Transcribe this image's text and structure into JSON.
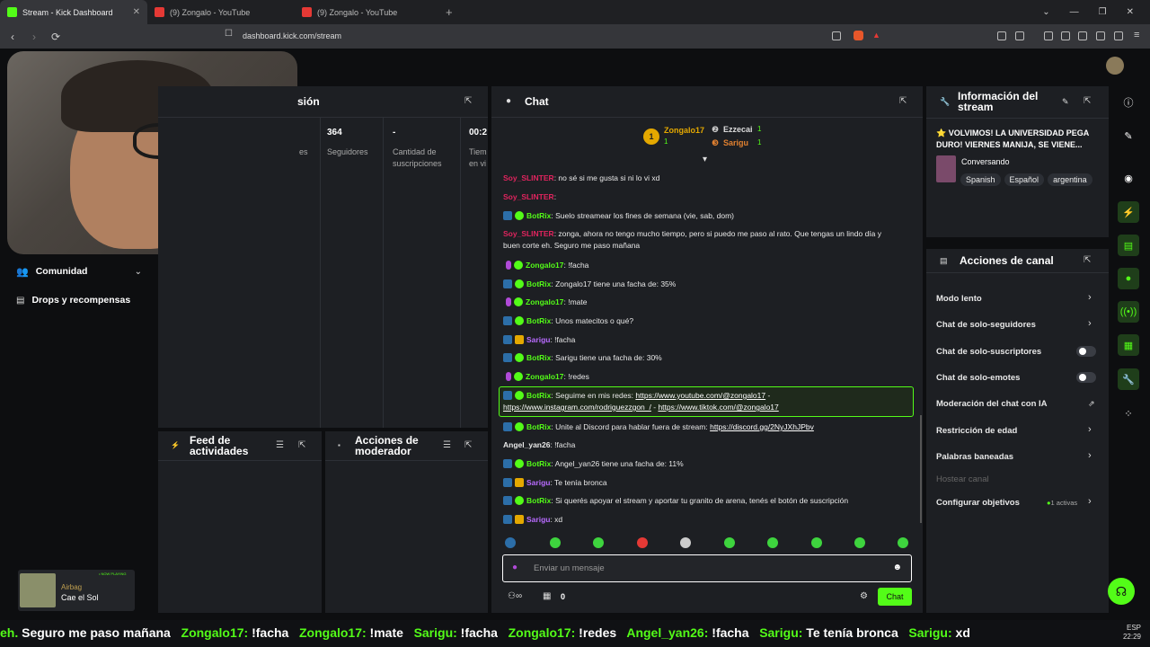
{
  "browser": {
    "tabs": [
      {
        "title": "Stream - Kick Dashboard",
        "active": true,
        "favicon": "#53fc18"
      },
      {
        "title": "(9) Zongalo - YouTube",
        "active": false,
        "favicon": "#e53935"
      },
      {
        "title": "(9) Zongalo - YouTube",
        "active": false,
        "favicon": "#e53935"
      }
    ],
    "url": "dashboard.kick.com/stream"
  },
  "left_nav": {
    "items": [
      {
        "label": "Comunidad"
      },
      {
        "label": "Drops y recompensas"
      }
    ]
  },
  "session_panel": {
    "title_fragment": "sión",
    "stats": [
      {
        "value": "364",
        "label": "Seguidores"
      },
      {
        "value": "-",
        "label": "Cantidad de suscripciones"
      },
      {
        "value": "00:2",
        "label": "Tiem en vi"
      }
    ],
    "partial_label": "es"
  },
  "activity_feed": {
    "title": "Feed de actividades"
  },
  "mod_actions": {
    "title": "Acciones de moderador"
  },
  "now_playing": {
    "badge": "• NOW PLAYING",
    "artist": "Airbag",
    "song": "Cae el Sol"
  },
  "chat": {
    "title": "Chat",
    "leaderboard": [
      {
        "rank": "1",
        "user": "Zongalo17",
        "count": "1"
      },
      {
        "user": "Ezzecai",
        "count": "1"
      },
      {
        "user": "Sarigu",
        "count": "1"
      }
    ],
    "messages": [
      {
        "user": "Soy_SLINTER",
        "user_color": "#e0245e",
        "text": ": no sé si me gusta si ni lo vi xd",
        "badges": []
      },
      {
        "user": "Soy_SLINTER",
        "user_color": "#e0245e",
        "text": ":",
        "badges": []
      },
      {
        "user": "BotRix",
        "user_color": "#53fc18",
        "text": ": Suelo streamear los fines de semana (vie, sab, dom)",
        "badges": [
          "mod",
          "ver"
        ]
      },
      {
        "user": "Soy_SLINTER",
        "user_color": "#e0245e",
        "text": ": zonga, ahora no tengo mucho tiempo, pero si puedo me paso al rato. Que tengas un lindo día y",
        "text2": "buen corte eh. Seguro me paso mañana",
        "badges": []
      },
      {
        "user": "Zongalo17",
        "user_color": "#53fc18",
        "text": ": !facha",
        "badges": [
          "mic",
          "ver"
        ]
      },
      {
        "user": "BotRix",
        "user_color": "#53fc18",
        "text": ": Zongalo17 tiene una facha de: 35%",
        "badges": [
          "mod",
          "ver"
        ]
      },
      {
        "user": "Zongalo17",
        "user_color": "#53fc18",
        "text": ": !mate",
        "badges": [
          "mic",
          "ver"
        ]
      },
      {
        "user": "BotRix",
        "user_color": "#53fc18",
        "text": ": Unos matecitos o qué?",
        "badges": [
          "mod",
          "ver"
        ]
      },
      {
        "user": "Sarigu",
        "user_color": "#b86bff",
        "text": ": !facha",
        "badges": [
          "mod",
          "crown"
        ]
      },
      {
        "user": "BotRix",
        "user_color": "#53fc18",
        "text": ": Sarigu tiene una facha de: 30%",
        "badges": [
          "mod",
          "ver"
        ]
      },
      {
        "user": "Zongalo17",
        "user_color": "#53fc18",
        "text": ": !redes",
        "badges": [
          "mic",
          "ver"
        ]
      },
      {
        "user": "BotRix",
        "user_color": "#53fc18",
        "text": ": Seguime en mis redes: ",
        "link1": "https://www.youtube.com/@zongalo17",
        "sep1": " -",
        "link2": "https://www.instagram.com/rodriguezzgon_/",
        "sep2": " - ",
        "link3": "https://www.tiktok.com/@zongalo17",
        "badges": [
          "mod",
          "ver"
        ]
      },
      {
        "user": "BotRix",
        "user_color": "#53fc18",
        "text": ": Unite al Discord para hablar fuera de stream: ",
        "link1": "https://discord.gg/2NyJXhJPbv",
        "badges": [
          "mod",
          "ver"
        ]
      },
      {
        "user": "Angel_yan26",
        "user_color": "#e8e8e8",
        "text": ": !facha",
        "badges": []
      },
      {
        "user": "BotRix",
        "user_color": "#53fc18",
        "text": ": Angel_yan26 tiene una facha de: 11%",
        "badges": [
          "mod",
          "ver"
        ]
      },
      {
        "user": "Sarigu",
        "user_color": "#b86bff",
        "text": ": Te tenía bronca",
        "badges": [
          "mod",
          "crown"
        ]
      },
      {
        "user": "BotRix",
        "user_color": "#53fc18",
        "text": ": Si querés apoyar el stream y aportar tu granito de arena, tenés el botón de suscripción",
        "badges": [
          "mod",
          "ver"
        ]
      },
      {
        "user": "Sarigu",
        "user_color": "#b86bff",
        "text": ": xd",
        "badges": [
          "mod",
          "crown"
        ]
      }
    ],
    "input_placeholder": "Enviar un mensaje",
    "points": "0",
    "send_label": "Chat"
  },
  "stream_info": {
    "title": "Información del stream",
    "stream_title": "⭐ VOLVIMOS! LA UNIVERSIDAD PEGA DURO! VIERNES MANIJA, SE VIENE...",
    "category": "Conversando",
    "tags": [
      "Spanish",
      "Español",
      "argentina"
    ]
  },
  "channel_actions": {
    "title": "Acciones de canal",
    "items": [
      {
        "label": "Modo lento",
        "control": "chevron"
      },
      {
        "label": "Chat de solo-seguidores",
        "control": "chevron"
      },
      {
        "label": "Chat de solo-suscriptores",
        "control": "toggle"
      },
      {
        "label": "Chat de solo-emotes",
        "control": "toggle"
      },
      {
        "label": "Moderación del chat con IA",
        "control": "external"
      },
      {
        "label": "Restricción de edad",
        "control": "chevron"
      },
      {
        "label": "Palabras baneadas",
        "control": "chevron"
      },
      {
        "label": "Hostear canal",
        "control": "none",
        "disabled": true
      },
      {
        "label": "Configurar objetivos",
        "control": "chevron",
        "extra": "1 activas"
      }
    ]
  },
  "ticker_items": [
    {
      "user": "eh.",
      "text": " Seguro me paso mañana"
    },
    {
      "user": "Zongalo17:",
      "text": " !facha"
    },
    {
      "user": "Zongalo17:",
      "text": " !mate"
    },
    {
      "user": "Sarigu:",
      "text": " !facha"
    },
    {
      "user": "Zongalo17:",
      "text": " !redes"
    },
    {
      "user": "Angel_yan26:",
      "text": " !facha"
    },
    {
      "user": "Sarigu:",
      "text": " Te tenía bronca"
    },
    {
      "user": "Sarigu:",
      "text": " xd"
    }
  ],
  "clock": {
    "lang": "ESP",
    "time": "22:29"
  }
}
